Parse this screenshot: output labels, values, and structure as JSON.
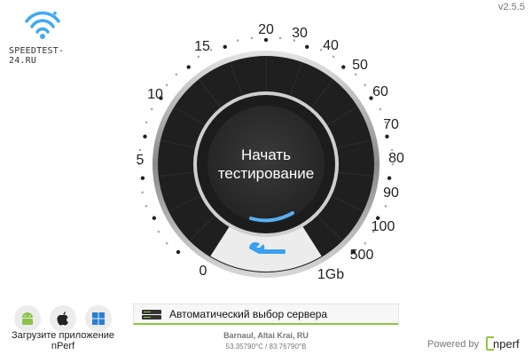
{
  "header": {
    "logo_text": "SPEEDTEST-24.RU",
    "version": "v2.5.5"
  },
  "gauge": {
    "start_line1": "Начать",
    "start_line2": "тестирование",
    "scale_labels": [
      "0",
      "5",
      "10",
      "15",
      "20",
      "30",
      "40",
      "50",
      "60",
      "70",
      "80",
      "90",
      "100",
      "500",
      "1Gb"
    ],
    "colors": {
      "face": "#1f1f1f",
      "hub": "#333333",
      "bezel": "#9a9a9a",
      "progress": "#5aaef2",
      "wrench": "#3aa0f0",
      "cutout": "#eeeeee"
    }
  },
  "apps": {
    "caption_line1": "Загрузите приложение",
    "caption_line2": "nPerf",
    "icons": [
      "android-icon",
      "apple-icon",
      "windows-icon"
    ]
  },
  "server": {
    "label": "Автоматический выбор сервера",
    "location": "Barnaul, Altai Krai, RU",
    "coords": "53.35790°C / 83.76790°B"
  },
  "footer": {
    "powered_by": "Powered by",
    "brand": "nperf"
  }
}
